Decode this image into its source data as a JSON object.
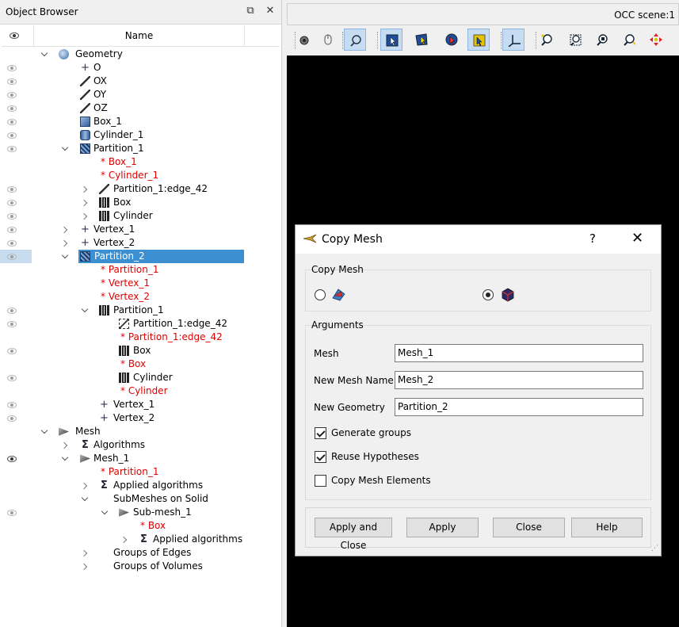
{
  "object_browser": {
    "title": "Object Browser",
    "column_name": "Name",
    "tree": [
      {
        "label": "Geometry",
        "level": 0,
        "icon": "geometry-icon",
        "arrow": "down",
        "eye": "none",
        "red": false
      },
      {
        "label": "O",
        "level": 1,
        "icon": "point-icon",
        "arrow": "none",
        "eye": "light",
        "red": false
      },
      {
        "label": "OX",
        "level": 1,
        "icon": "line-icon",
        "arrow": "none",
        "eye": "light",
        "red": false
      },
      {
        "label": "OY",
        "level": 1,
        "icon": "line-icon",
        "arrow": "none",
        "eye": "light",
        "red": false
      },
      {
        "label": "OZ",
        "level": 1,
        "icon": "line-icon",
        "arrow": "none",
        "eye": "light",
        "red": false
      },
      {
        "label": "Box_1",
        "level": 1,
        "icon": "box-icon",
        "arrow": "none",
        "eye": "light",
        "red": false
      },
      {
        "label": "Cylinder_1",
        "level": 1,
        "icon": "cylinder-icon",
        "arrow": "none",
        "eye": "light",
        "red": false
      },
      {
        "label": "Partition_1",
        "level": 1,
        "icon": "partition-icon",
        "arrow": "down",
        "eye": "light",
        "red": false
      },
      {
        "label": "* Box_1",
        "level": 2,
        "icon": "none",
        "arrow": "none",
        "eye": "none",
        "red": true
      },
      {
        "label": "* Cylinder_1",
        "level": 2,
        "icon": "none",
        "arrow": "none",
        "eye": "none",
        "red": true
      },
      {
        "label": "Partition_1:edge_42",
        "level": 2,
        "icon": "line-icon",
        "arrow": "right",
        "eye": "light",
        "red": false
      },
      {
        "label": "Box",
        "level": 2,
        "icon": "group-icon",
        "arrow": "right",
        "eye": "light",
        "red": false
      },
      {
        "label": "Cylinder",
        "level": 2,
        "icon": "group-icon",
        "arrow": "right",
        "eye": "light",
        "red": false
      },
      {
        "label": "Vertex_1",
        "level": 1,
        "icon": "point-icon",
        "arrow": "right",
        "eye": "light",
        "red": false
      },
      {
        "label": "Vertex_2",
        "level": 1,
        "icon": "point-icon",
        "arrow": "right",
        "eye": "light",
        "red": false
      },
      {
        "label": "Partition_2",
        "level": 1,
        "icon": "partition-icon",
        "arrow": "down",
        "eye": "light",
        "red": false,
        "selected": true
      },
      {
        "label": "* Partition_1",
        "level": 2,
        "icon": "none",
        "arrow": "none",
        "eye": "none",
        "red": true
      },
      {
        "label": "* Vertex_1",
        "level": 2,
        "icon": "none",
        "arrow": "none",
        "eye": "none",
        "red": true
      },
      {
        "label": "* Vertex_2",
        "level": 2,
        "icon": "none",
        "arrow": "none",
        "eye": "none",
        "red": true
      },
      {
        "label": "Partition_1",
        "level": 2,
        "icon": "group-icon",
        "arrow": "down",
        "eye": "light",
        "red": false
      },
      {
        "label": "Partition_1:edge_42",
        "level": 3,
        "icon": "edge-group-icon",
        "arrow": "none",
        "eye": "light",
        "red": false
      },
      {
        "label": "* Partition_1:edge_42",
        "level": 3,
        "icon": "none",
        "arrow": "none",
        "eye": "none",
        "red": true
      },
      {
        "label": "Box",
        "level": 3,
        "icon": "group-icon",
        "arrow": "none",
        "eye": "light",
        "red": false
      },
      {
        "label": "* Box",
        "level": 3,
        "icon": "none",
        "arrow": "none",
        "eye": "none",
        "red": true
      },
      {
        "label": "Cylinder",
        "level": 3,
        "icon": "group-icon",
        "arrow": "none",
        "eye": "light",
        "red": false
      },
      {
        "label": "* Cylinder",
        "level": 3,
        "icon": "none",
        "arrow": "none",
        "eye": "none",
        "red": true
      },
      {
        "label": "Vertex_1",
        "level": 2,
        "icon": "point-icon",
        "arrow": "none",
        "eye": "light",
        "red": false
      },
      {
        "label": "Vertex_2",
        "level": 2,
        "icon": "point-icon",
        "arrow": "none",
        "eye": "light",
        "red": false
      },
      {
        "label": "Mesh",
        "level": 0,
        "icon": "mesh-icon",
        "arrow": "down",
        "eye": "none",
        "red": false
      },
      {
        "label": "Algorithms",
        "level": 1,
        "icon": "algorithm-icon",
        "arrow": "right",
        "eye": "none",
        "red": false
      },
      {
        "label": "Mesh_1",
        "level": 1,
        "icon": "mesh-object-icon",
        "arrow": "down",
        "eye": "dark",
        "red": false
      },
      {
        "label": "* Partition_1",
        "level": 2,
        "icon": "none",
        "arrow": "none",
        "eye": "none",
        "red": true
      },
      {
        "label": "Applied algorithms",
        "level": 2,
        "icon": "algorithm-icon",
        "arrow": "right",
        "eye": "none",
        "red": false
      },
      {
        "label": "SubMeshes on Solid",
        "level": 2,
        "icon": "none",
        "arrow": "down",
        "eye": "none",
        "red": false
      },
      {
        "label": "Sub-mesh_1",
        "level": 3,
        "icon": "mesh-object-icon",
        "arrow": "down",
        "eye": "light",
        "red": false
      },
      {
        "label": "* Box",
        "level": 4,
        "icon": "none",
        "arrow": "none",
        "eye": "none",
        "red": true
      },
      {
        "label": "Applied algorithms",
        "level": 4,
        "icon": "algorithm-icon",
        "arrow": "right",
        "eye": "none",
        "red": false
      },
      {
        "label": "Groups of Edges",
        "level": 2,
        "icon": "none",
        "arrow": "right",
        "eye": "none",
        "red": false
      },
      {
        "label": "Groups of Volumes",
        "level": 2,
        "icon": "none",
        "arrow": "right",
        "eye": "none",
        "red": false
      }
    ]
  },
  "viewer": {
    "title": "OCC scene:1",
    "toolbar": [
      {
        "name": "dump-view-button",
        "icon": "camera-icon",
        "on": false
      },
      {
        "name": "mouse-interaction-button",
        "icon": "mouse-icon",
        "on": false
      },
      {
        "name": "rotation-point-button",
        "icon": "rotation-point-icon",
        "on": true
      },
      {
        "name": "select-rectangle-button",
        "icon": "select-rect-icon",
        "on": true
      },
      {
        "name": "select-polygon-button",
        "icon": "select-polygon-icon",
        "on": false
      },
      {
        "name": "select-circle-button",
        "icon": "select-circle-icon",
        "on": false
      },
      {
        "name": "select-highlight-button",
        "icon": "select-highlight-icon",
        "on": true
      },
      {
        "name": "show-trihedron-button",
        "icon": "trihedron-icon",
        "on": true
      },
      {
        "name": "fit-all-button",
        "icon": "fit-all-icon",
        "on": false
      },
      {
        "name": "fit-area-button",
        "icon": "fit-area-icon",
        "on": false
      },
      {
        "name": "fit-selection-button",
        "icon": "fit-selection-icon",
        "on": false
      },
      {
        "name": "zoom-button",
        "icon": "zoom-icon",
        "on": false
      },
      {
        "name": "pan-button",
        "icon": "pan-icon",
        "on": false
      }
    ]
  },
  "dialog": {
    "title": "Copy Mesh",
    "help_mark": "?",
    "close_mark": "✕",
    "group_copy_mesh": "Copy Mesh",
    "group_arguments": "Arguments",
    "mesh_label": "Mesh",
    "mesh_value": "Mesh_1",
    "new_mesh_name_label": "New Mesh Name",
    "new_mesh_name_value": "Mesh_2",
    "new_geometry_label": "New Geometry",
    "new_geometry_value": "Partition_2",
    "generate_groups_label": "Generate groups",
    "generate_groups_checked": true,
    "reuse_hypotheses_label": "Reuse Hypotheses",
    "reuse_hypotheses_checked": true,
    "copy_elements_label": "Copy Mesh Elements",
    "copy_elements_checked": false,
    "btn_apply_close": "Apply and Close",
    "btn_apply": "Apply",
    "btn_close": "Close",
    "btn_help": "Help"
  }
}
